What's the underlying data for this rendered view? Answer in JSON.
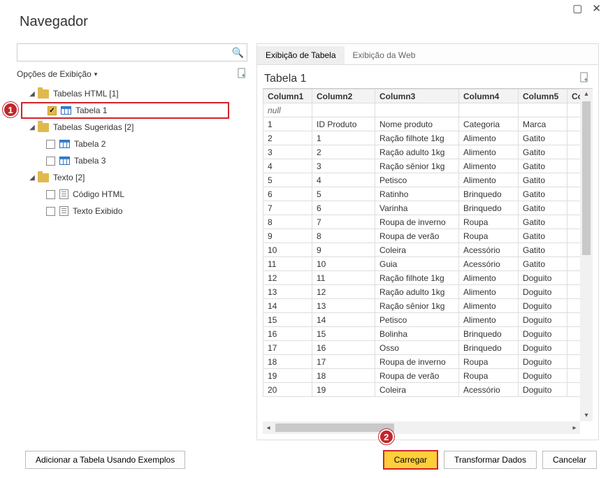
{
  "window": {
    "title": "Navegador",
    "search_placeholder": "",
    "display_options_label": "Opções de Exibição",
    "add_table_examples": "Adicionar a Tabela Usando Exemplos",
    "load_button": "Carregar",
    "transform_button": "Transformar Dados",
    "cancel_button": "Cancelar"
  },
  "callouts": {
    "one": "1",
    "two": "2"
  },
  "tree": {
    "group_html_tables": "Tabelas HTML [1]",
    "table1": "Tabela 1",
    "group_suggested": "Tabelas Sugeridas [2]",
    "table2": "Tabela 2",
    "table3": "Tabela 3",
    "group_text": "Texto [2]",
    "code_html": "Código HTML",
    "text_shown": "Texto Exibido"
  },
  "preview": {
    "tab_table": "Exibição de Tabela",
    "tab_web": "Exibição da Web",
    "title": "Tabela 1",
    "null_label": "null",
    "headers": {
      "c1": "Column1",
      "c2": "Column2",
      "c3": "Column3",
      "c4": "Column4",
      "c5": "Column5",
      "c6": "Colu"
    }
  },
  "chart_data": {
    "type": "table",
    "columns": [
      "Column1",
      "Column2",
      "Column3",
      "Column4",
      "Column5"
    ],
    "rows": [
      [
        "null",
        "",
        "",
        "",
        ""
      ],
      [
        "1",
        "ID Produto",
        "Nome produto",
        "Categoria",
        "Marca"
      ],
      [
        "2",
        "1",
        "Ração filhote 1kg",
        "Alimento",
        "Gatito"
      ],
      [
        "3",
        "2",
        "Ração adulto 1kg",
        "Alimento",
        "Gatito"
      ],
      [
        "4",
        "3",
        "Ração sênior 1kg",
        "Alimento",
        "Gatito"
      ],
      [
        "5",
        "4",
        "Petisco",
        "Alimento",
        "Gatito"
      ],
      [
        "6",
        "5",
        "Ratinho",
        "Brinquedo",
        "Gatito"
      ],
      [
        "7",
        "6",
        "Varinha",
        "Brinquedo",
        "Gatito"
      ],
      [
        "8",
        "7",
        "Roupa de inverno",
        "Roupa",
        "Gatito"
      ],
      [
        "9",
        "8",
        "Roupa de verão",
        "Roupa",
        "Gatito"
      ],
      [
        "10",
        "9",
        "Coleira",
        "Acessório",
        "Gatito"
      ],
      [
        "11",
        "10",
        "Guia",
        "Acessório",
        "Gatito"
      ],
      [
        "12",
        "11",
        "Ração filhote 1kg",
        "Alimento",
        "Doguito"
      ],
      [
        "13",
        "12",
        "Ração adulto 1kg",
        "Alimento",
        "Doguito"
      ],
      [
        "14",
        "13",
        "Ração sênior 1kg",
        "Alimento",
        "Doguito"
      ],
      [
        "15",
        "14",
        "Petisco",
        "Alimento",
        "Doguito"
      ],
      [
        "16",
        "15",
        "Bolinha",
        "Brinquedo",
        "Doguito"
      ],
      [
        "17",
        "16",
        "Osso",
        "Brinquedo",
        "Doguito"
      ],
      [
        "18",
        "17",
        "Roupa de inverno",
        "Roupa",
        "Doguito"
      ],
      [
        "19",
        "18",
        "Roupa de verão",
        "Roupa",
        "Doguito"
      ],
      [
        "20",
        "19",
        "Coleira",
        "Acessório",
        "Doguito"
      ]
    ]
  }
}
